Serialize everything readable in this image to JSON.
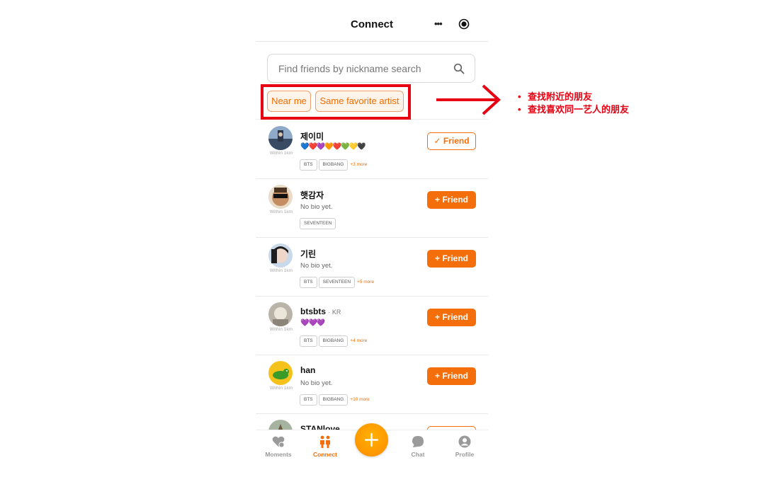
{
  "header": {
    "title": "Connect"
  },
  "search": {
    "placeholder": "Find friends by nickname search"
  },
  "filters": [
    {
      "label": "Near me"
    },
    {
      "label": "Same favorite artist"
    }
  ],
  "annotations": [
    "查找附近的朋友",
    "查找喜欢同一艺人的朋友"
  ],
  "annotation_color": "#e60012",
  "accent_color": "#f46e0c",
  "friends": [
    {
      "name": "제이미",
      "region": "",
      "distance": "Within 1km",
      "hearts": "💙❤️💜🧡❤️💚💛🖤",
      "bio": "",
      "tags": [
        "BTS",
        "BIGBANG"
      ],
      "more": "+3 more",
      "button": "Friend",
      "is_friend": true
    },
    {
      "name": "햇감자",
      "region": "",
      "distance": "Within 1km",
      "hearts": "",
      "bio": "No bio yet.",
      "tags": [
        "SEVENTEEN"
      ],
      "more": "",
      "button": "Friend",
      "is_friend": false
    },
    {
      "name": "기린",
      "region": "",
      "distance": "Within 1km",
      "hearts": "",
      "bio": "No bio yet.",
      "tags": [
        "BTS",
        "SEVENTEEN"
      ],
      "more": "+5 more",
      "button": "Friend",
      "is_friend": false
    },
    {
      "name": "btsbts",
      "region": "· KR",
      "distance": "Within 1km",
      "hearts": "💜💜💜",
      "bio": "",
      "tags": [
        "BTS",
        "BIGBANG"
      ],
      "more": "+4 more",
      "button": "Friend",
      "is_friend": false
    },
    {
      "name": "han",
      "region": "",
      "distance": "Within 1km",
      "hearts": "",
      "bio": "No bio yet.",
      "tags": [
        "BTS",
        "BIGBANG"
      ],
      "more": "+10 more",
      "button": "Friend",
      "is_friend": false
    },
    {
      "name": "STANlove",
      "region": "",
      "distance": "",
      "hearts": "",
      "bio": "",
      "tags": [],
      "more": "",
      "button": "",
      "is_friend": false
    }
  ],
  "tabs": [
    {
      "label": "Moments",
      "icon": "heart-chat-icon"
    },
    {
      "label": "Connect",
      "icon": "people-icon"
    },
    {
      "label": "Chat",
      "icon": "chat-bubble-icon"
    },
    {
      "label": "Profile",
      "icon": "profile-icon"
    }
  ]
}
